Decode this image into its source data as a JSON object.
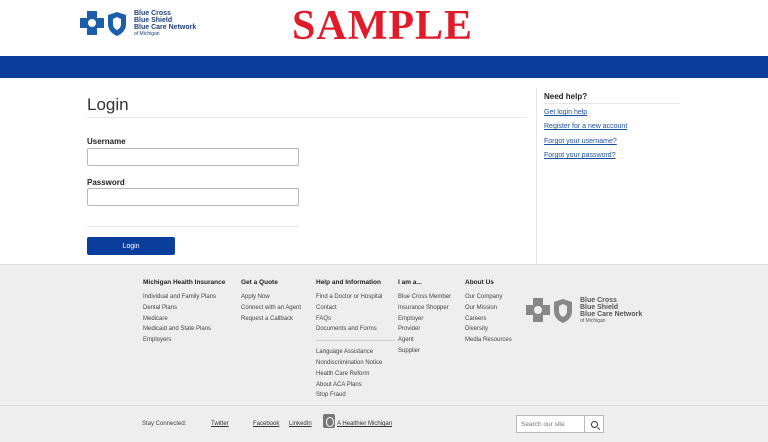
{
  "header": {
    "logo_line1": "Blue Cross",
    "logo_line2": "Blue Shield",
    "logo_line3": "Blue Care Network",
    "logo_line4": "of Michigan",
    "watermark": "SAMPLE"
  },
  "login": {
    "title": "Login",
    "username_label": "Username",
    "username_value": "",
    "password_label": "Password",
    "password_value": "",
    "button_label": "Login"
  },
  "help": {
    "title": "Need help?",
    "links": [
      "Get login help",
      "Register for a new account",
      "Forgot your username?",
      "Forgot your password?"
    ]
  },
  "footer": {
    "columns": [
      {
        "title": "Michigan Health Insurance",
        "items": [
          "Individual and Family Plans",
          "Dental Plans",
          "Medicare",
          "Medicaid and State Plans",
          "Employers"
        ]
      },
      {
        "title": "Get a Quote",
        "items": [
          "Apply Now",
          "Connect with an Agent",
          "Request a Callback"
        ]
      },
      {
        "title": "Help and Information",
        "items": [
          "Find a Doctor or Hospital",
          "Contact",
          "FAQs",
          "Documents and Forms"
        ],
        "items2": [
          "Language Assistance",
          "Nondiscrimination Notice",
          "Health Care Reform",
          "About ACA Plans",
          "Stop Fraud"
        ]
      },
      {
        "title": "I am a...",
        "items": [
          "Blue Cross Member",
          "Insurance Shopper",
          "Employer",
          "Provider",
          "Agent",
          "Supplier"
        ]
      },
      {
        "title": "About Us",
        "items": [
          "Our Company",
          "Our Mission",
          "Careers",
          "Diversity",
          "Media Resources"
        ]
      }
    ],
    "stay_connected": "Stay Connected:",
    "social": [
      "Twitter",
      "Facebook",
      "LinkedIn",
      "A Healthier Michigan"
    ],
    "search_placeholder": "Search our site"
  },
  "colors": {
    "brand_blue": "#0b3d9c",
    "watermark_red": "#e11c2a",
    "link_blue": "#1a4fa0"
  },
  "icons": [
    "blue-cross-icon",
    "blue-shield-icon",
    "search-icon",
    "healthier-michigan-icon"
  ]
}
